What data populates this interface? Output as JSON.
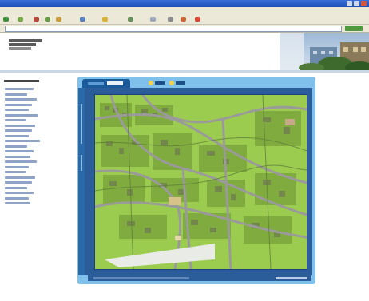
{
  "browser": {
    "title": "",
    "menu_items": [
      "",
      "",
      "",
      "",
      "",
      ""
    ],
    "address": "",
    "go_label": ""
  },
  "site": {
    "logo_text": ""
  },
  "sidebar": {
    "heading": "",
    "items": [
      "",
      "",
      "",
      "",
      "",
      "",
      "",
      "",
      "",
      "",
      "",
      "",
      "",
      "",
      "",
      "",
      "",
      "",
      "",
      "",
      "",
      "",
      ""
    ]
  },
  "map": {
    "title": "",
    "tab_left": "",
    "tab_right": "",
    "footer_text": "",
    "copyright": "",
    "colors": {
      "frame": "#7fc1ea",
      "panel": "#2a5d9a",
      "grass": "#9ccc4f",
      "road": "#9a9a9a",
      "building": "#5a7a3a"
    }
  }
}
